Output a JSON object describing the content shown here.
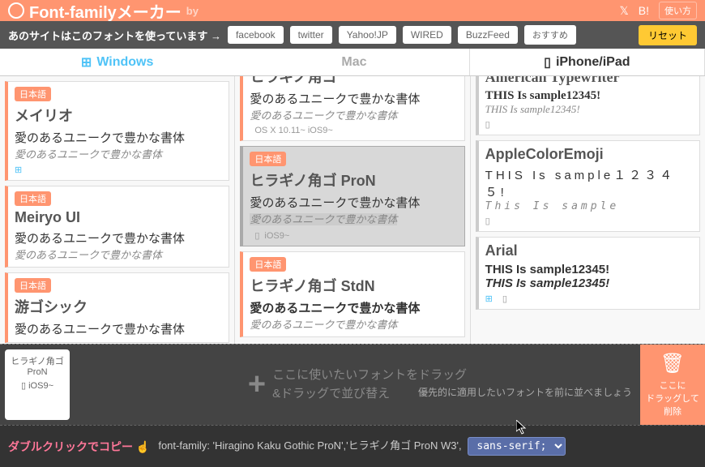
{
  "header": {
    "title": "Font-familyメーカー",
    "by": "by",
    "usage": "使い方"
  },
  "sitebar": {
    "label": "あのサイトはこのフォントを使っています →",
    "sites": [
      "facebook",
      "twitter",
      "Yahoo!JP",
      "WIRED",
      "BuzzFeed",
      "おすすめ"
    ],
    "reset": "リセット"
  },
  "tabs": {
    "win": "Windows",
    "mac": "Mac",
    "ios": "iPhone/iPad"
  },
  "tag_jp": "日本語",
  "sample_jp": "愛のあるユニークで豊かな書体",
  "col_win": [
    {
      "name": "メイリオ",
      "meta": ""
    },
    {
      "name": "Meiryo UI",
      "meta": ""
    },
    {
      "name": "游ゴシック",
      "meta": ""
    }
  ],
  "col_mac": [
    {
      "name": "ヒラギノ角ゴ",
      "meta": "OS X 10.11~  iOS9~"
    },
    {
      "name": "ヒラギノ角ゴ ProN",
      "meta": "iOS9~",
      "selected": true
    },
    {
      "name": "ヒラギノ角ゴ StdN",
      "meta": ""
    }
  ],
  "col_ios": [
    {
      "name": "American Typewriter",
      "s1": "THIS Is sample12345!",
      "s2": "THIS Is sample12345!"
    },
    {
      "name": "AppleColorEmoji",
      "s1": "THIS Is sample１２３４５!",
      "s2": "This Is sample"
    },
    {
      "name": "Arial",
      "s1": "THIS Is sample12345!",
      "s2": "THIS Is sample12345!"
    }
  ],
  "drag": {
    "chip_name": "ヒラギノ角ゴ ProN",
    "chip_meta": "iOS9~",
    "text1": "ここに使いたいフォントをドラッグ",
    "text2": "&ドラッグで並び替え",
    "delete_text": "ここに\nドラッグして\n削除",
    "hint": "優先的に適用したいフォントを前に並べましょう"
  },
  "code": {
    "copy_label": "ダブルクリックでコピー",
    "css": "font-family: 'Hiragino Kaku Gothic ProN','ヒラギノ角ゴ ProN W3',",
    "fallback": "sans-serif;"
  }
}
